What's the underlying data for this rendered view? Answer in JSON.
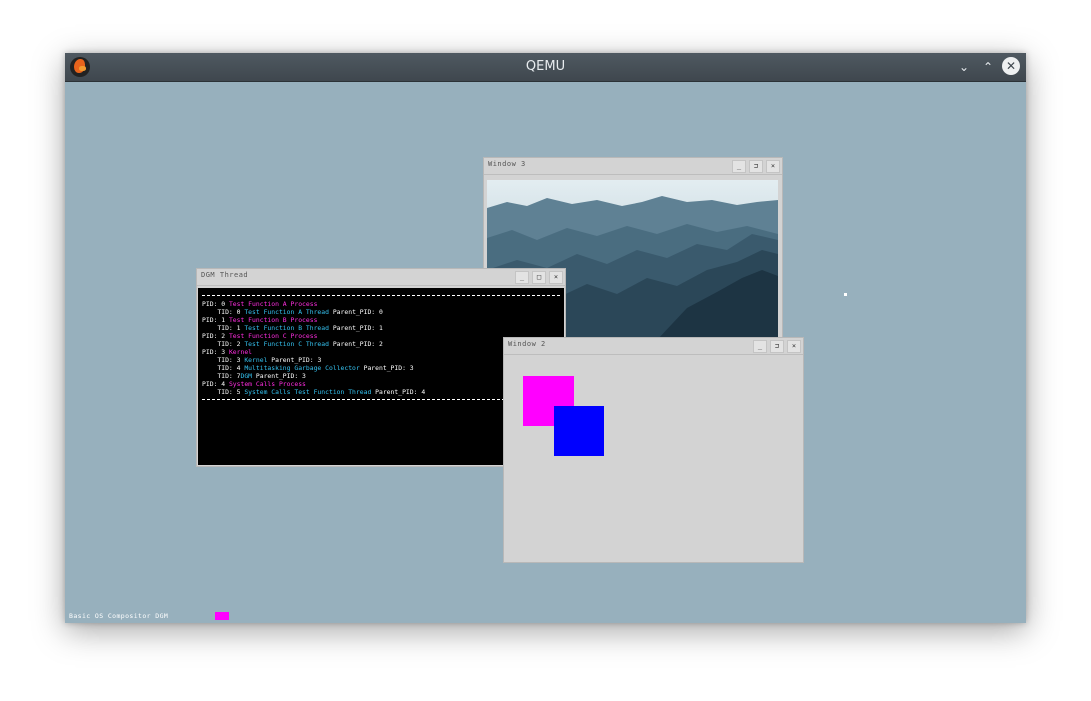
{
  "titlebar": {
    "title": "QEMU",
    "minimize_icon": "chevron-down-icon",
    "maximize_icon": "chevron-up-icon",
    "close_icon": "close-icon",
    "min_glyph": "⌄",
    "max_glyph": "⌃",
    "close_glyph": "✕"
  },
  "window3": {
    "title": "Window 3",
    "min": "_",
    "max": "⊐",
    "close": "×"
  },
  "dgm_thread": {
    "title": "DGM Thread",
    "min": "_",
    "max": "□",
    "close": "×",
    "lines": [
      [
        {
          "t": "PID: 0 ",
          "c": "w"
        },
        {
          "t": "Test Function A Process",
          "c": "m"
        }
      ],
      [
        {
          "t": "    TID: 0 ",
          "c": "w"
        },
        {
          "t": "Test Function A Thread",
          "c": "c"
        },
        {
          "t": " Parent_PID: 0",
          "c": "w"
        }
      ],
      [
        {
          "t": "PID: 1 ",
          "c": "w"
        },
        {
          "t": "Test Function B Process",
          "c": "m"
        }
      ],
      [
        {
          "t": "    TID: 1 ",
          "c": "w"
        },
        {
          "t": "Test Function B Thread",
          "c": "c"
        },
        {
          "t": " Parent_PID: 1",
          "c": "w"
        }
      ],
      [
        {
          "t": "PID: 2 ",
          "c": "w"
        },
        {
          "t": "Test Function C Process",
          "c": "m"
        }
      ],
      [
        {
          "t": "    TID: 2 ",
          "c": "w"
        },
        {
          "t": "Test Function C Thread",
          "c": "c"
        },
        {
          "t": " Parent_PID: 2",
          "c": "w"
        }
      ],
      [
        {
          "t": "PID: 3 ",
          "c": "w"
        },
        {
          "t": "Kernel",
          "c": "m"
        }
      ],
      [
        {
          "t": "    TID: 3 ",
          "c": "w"
        },
        {
          "t": "Kernel",
          "c": "c"
        },
        {
          "t": " Parent_PID: 3",
          "c": "w"
        }
      ],
      [
        {
          "t": "    TID: 4 ",
          "c": "w"
        },
        {
          "t": "Multitasking Garbage Collector",
          "c": "c"
        },
        {
          "t": " Parent_PID: 3",
          "c": "w"
        }
      ],
      [
        {
          "t": "    TID: 7",
          "c": "w"
        },
        {
          "t": "DGM",
          "c": "c"
        },
        {
          "t": " Parent_PID: 3",
          "c": "w"
        }
      ],
      [
        {
          "t": "PID: 4 ",
          "c": "w"
        },
        {
          "t": "System Calls Process",
          "c": "m"
        }
      ],
      [
        {
          "t": "    TID: 5 ",
          "c": "w"
        },
        {
          "t": "System Calls Test Function Thread",
          "c": "c"
        },
        {
          "t": " Parent_PID: 4",
          "c": "w"
        }
      ]
    ]
  },
  "window2": {
    "title": "Window 2",
    "min": "_",
    "max": "⊐",
    "close": "×"
  },
  "taskbar": {
    "label": "Basic OS Compositor DGM"
  },
  "colors": {
    "desktop": "#97b0bd",
    "magenta": "#ff00ff",
    "blue": "#0000ff",
    "term_magenta": "#ff2de0",
    "term_cyan": "#35c2f0"
  }
}
